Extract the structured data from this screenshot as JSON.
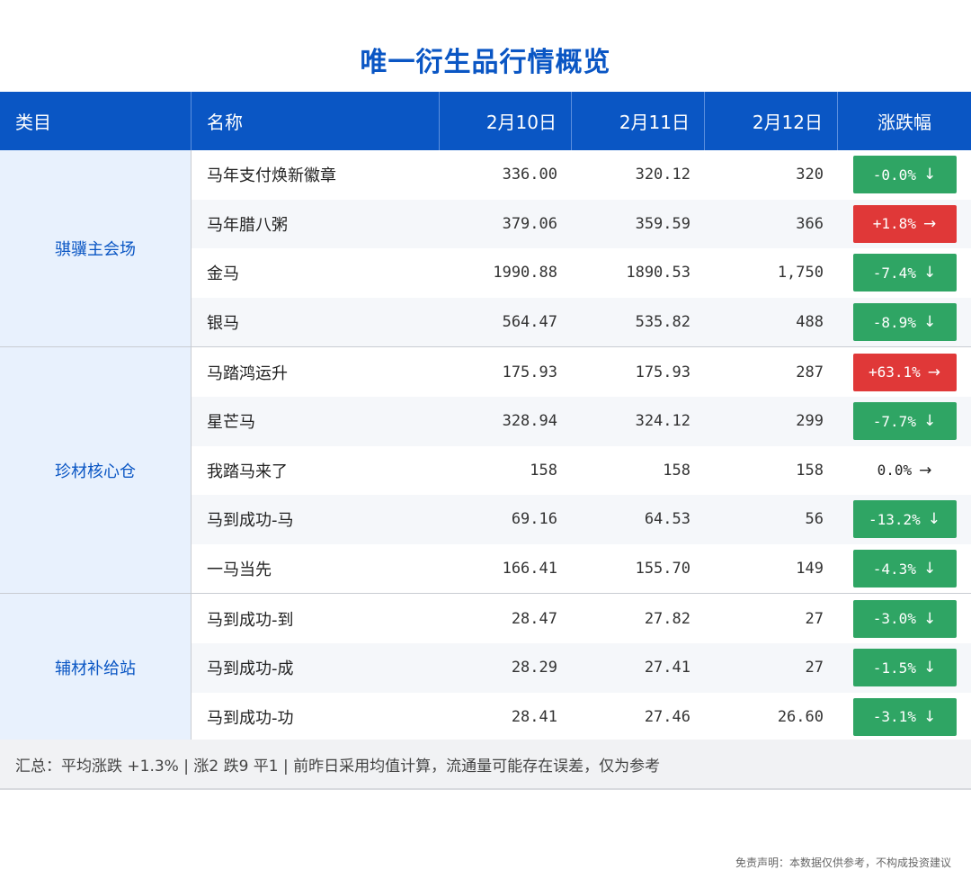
{
  "title": "唯一衍生品行情概览",
  "headers": {
    "category": "类目",
    "name": "名称",
    "d1": "2月10日",
    "d2": "2月11日",
    "d3": "2月12日",
    "change": "涨跌幅"
  },
  "groups": [
    {
      "category": "骐骥主会场",
      "rows": [
        {
          "name": "马年支付焕新徽章",
          "d1": "336.00",
          "d2": "320.12",
          "d3": "320",
          "change": "-0.0%",
          "dir": "down",
          "arrow": "↓"
        },
        {
          "name": "马年腊八粥",
          "d1": "379.06",
          "d2": "359.59",
          "d3": "366",
          "change": "+1.8%",
          "dir": "up",
          "arrow": "→"
        },
        {
          "name": "金马",
          "d1": "1990.88",
          "d2": "1890.53",
          "d3": "1,750",
          "change": "-7.4%",
          "dir": "down",
          "arrow": "↓"
        },
        {
          "name": "银马",
          "d1": "564.47",
          "d2": "535.82",
          "d3": "488",
          "change": "-8.9%",
          "dir": "down",
          "arrow": "↓"
        }
      ]
    },
    {
      "category": "珍材核心仓",
      "rows": [
        {
          "name": "马踏鸿运升",
          "d1": "175.93",
          "d2": "175.93",
          "d3": "287",
          "change": "+63.1%",
          "dir": "up",
          "arrow": "→"
        },
        {
          "name": "星芒马",
          "d1": "328.94",
          "d2": "324.12",
          "d3": "299",
          "change": "-7.7%",
          "dir": "down",
          "arrow": "↓"
        },
        {
          "name": "我踏马来了",
          "d1": "158",
          "d2": "158",
          "d3": "158",
          "change": "0.0%",
          "dir": "flat",
          "arrow": "→"
        },
        {
          "name": "马到成功-马",
          "d1": "69.16",
          "d2": "64.53",
          "d3": "56",
          "change": "-13.2%",
          "dir": "down",
          "arrow": "↓"
        },
        {
          "name": "一马当先",
          "d1": "166.41",
          "d2": "155.70",
          "d3": "149",
          "change": "-4.3%",
          "dir": "down",
          "arrow": "↓"
        }
      ]
    },
    {
      "category": "辅材补给站",
      "rows": [
        {
          "name": "马到成功-到",
          "d1": "28.47",
          "d2": "27.82",
          "d3": "27",
          "change": "-3.0%",
          "dir": "down",
          "arrow": "↓"
        },
        {
          "name": "马到成功-成",
          "d1": "28.29",
          "d2": "27.41",
          "d3": "27",
          "change": "-1.5%",
          "dir": "down",
          "arrow": "↓"
        },
        {
          "name": "马到成功-功",
          "d1": "28.41",
          "d2": "27.46",
          "d3": "26.60",
          "change": "-3.1%",
          "dir": "down",
          "arrow": "↓"
        }
      ]
    }
  ],
  "summary": "汇总：平均涨跌 +1.3% | 涨2 跌9 平1 | 前昨日采用均值计算，流通量可能存在误差，仅为参考",
  "disclaimer": "免责声明：本数据仅供参考，不构成投资建议",
  "colors": {
    "header": "#0a56c4",
    "down": "#2fa564",
    "up": "#e03838",
    "category_bg": "#e8f1fd"
  }
}
